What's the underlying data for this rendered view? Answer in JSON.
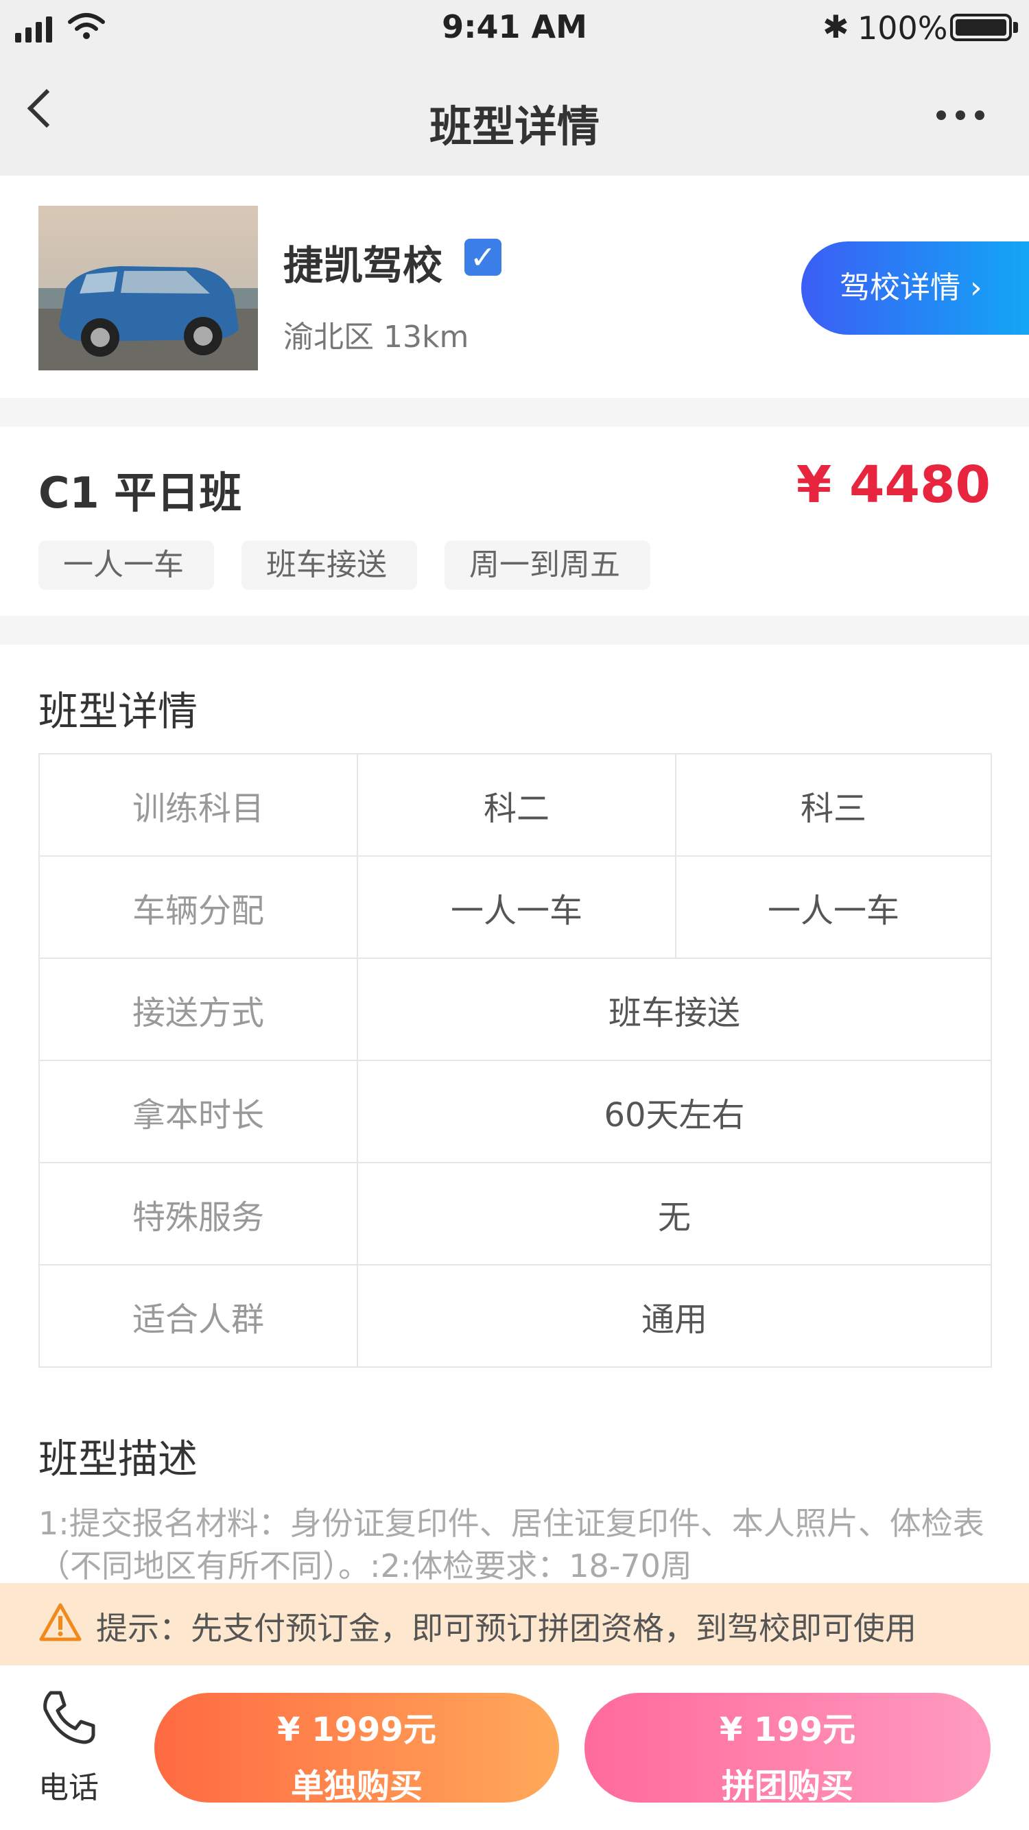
{
  "status_bar": {
    "time": "9:41 AM",
    "battery": "100%"
  },
  "nav": {
    "title": "班型详情"
  },
  "school": {
    "name": "捷凯驾校",
    "location": "渝北区 13km",
    "detail_button": "驾校详情 ›"
  },
  "class": {
    "title": "C1 平日班",
    "price": "¥ 4480",
    "tags": [
      "一人一车",
      "班车接送",
      "周一到周五"
    ]
  },
  "details_section": {
    "title": "班型详情",
    "rows": [
      {
        "label": "训练科目",
        "values": [
          "科二",
          "科三"
        ]
      },
      {
        "label": "车辆分配",
        "values": [
          "一人一车",
          "一人一车"
        ]
      },
      {
        "label": "接送方式",
        "values": [
          "班车接送"
        ]
      },
      {
        "label": "拿本时长",
        "values": [
          "60天左右"
        ]
      },
      {
        "label": "特殊服务",
        "values": [
          "无"
        ]
      },
      {
        "label": "适合人群",
        "values": [
          "通用"
        ]
      }
    ]
  },
  "description_section": {
    "title": "班型描述",
    "text": "1:提交报名材料：身份证复印件、居住证复印件、本人照片、体检表（不同地区有所不同）。:2:体检要求：18-70周"
  },
  "tip": {
    "text": "提示：先支付预订金，即可预订拼团资格，到驾校即可使用"
  },
  "bottom_bar": {
    "phone_label": "电话",
    "solo": {
      "price": "¥ 1999元",
      "label": "单独购买"
    },
    "group": {
      "price": "¥ 199元",
      "label": "拼团购买"
    }
  },
  "colors": {
    "accent_red": "#e8253f",
    "blue_gradient_start": "#3b5ef5",
    "orange_start": "#ff6a42",
    "pink_start": "#ff6a9c"
  }
}
